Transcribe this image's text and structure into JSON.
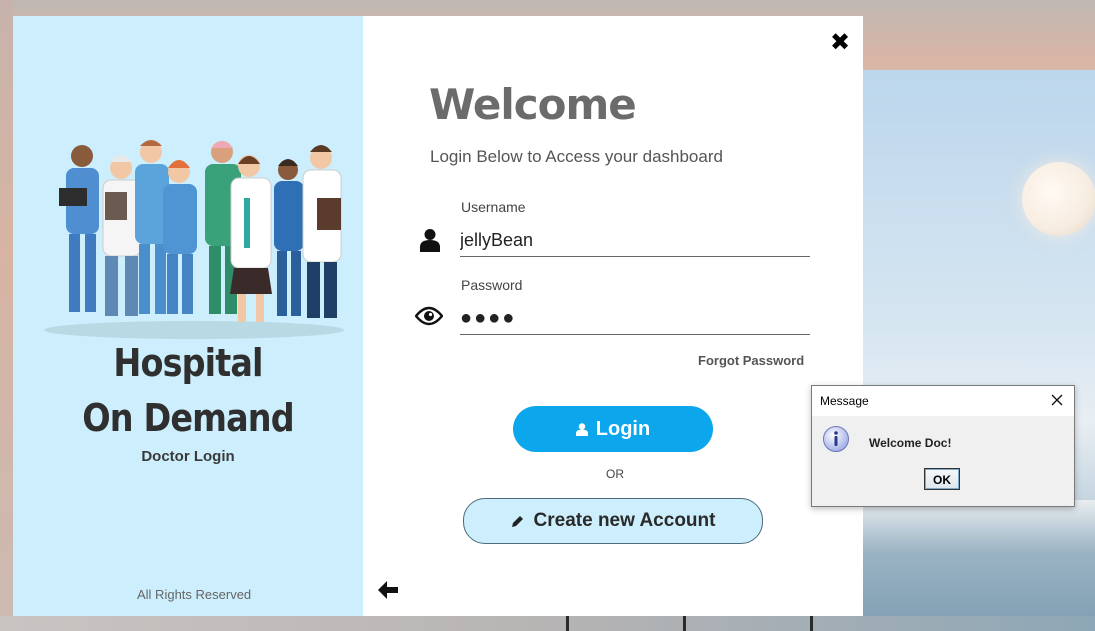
{
  "brand": {
    "line1": "Hospital",
    "line2": "On Demand",
    "subtitle": "Doctor Login",
    "footer": "All Rights Reserved"
  },
  "login": {
    "title": "Welcome",
    "subtitle": "Login Below to Access your dashboard",
    "username_label": "Username",
    "username_value": "jellyBean",
    "password_label": "Password",
    "password_value": "●●●●",
    "forgot_label": "Forgot Password",
    "login_label": "Login",
    "or_label": "OR",
    "create_label": "Create new Account",
    "close_icon": "close-icon",
    "back_icon": "arrow-left-icon"
  },
  "dialog": {
    "title": "Message",
    "message": "Welcome Doc!",
    "ok_label": "OK",
    "icon": "info-icon"
  },
  "colors": {
    "left_panel": "#cdeffd",
    "primary_button": "#0ca6ec",
    "secondary_button": "#cdeffd",
    "title_text": "#6b6b6b"
  }
}
